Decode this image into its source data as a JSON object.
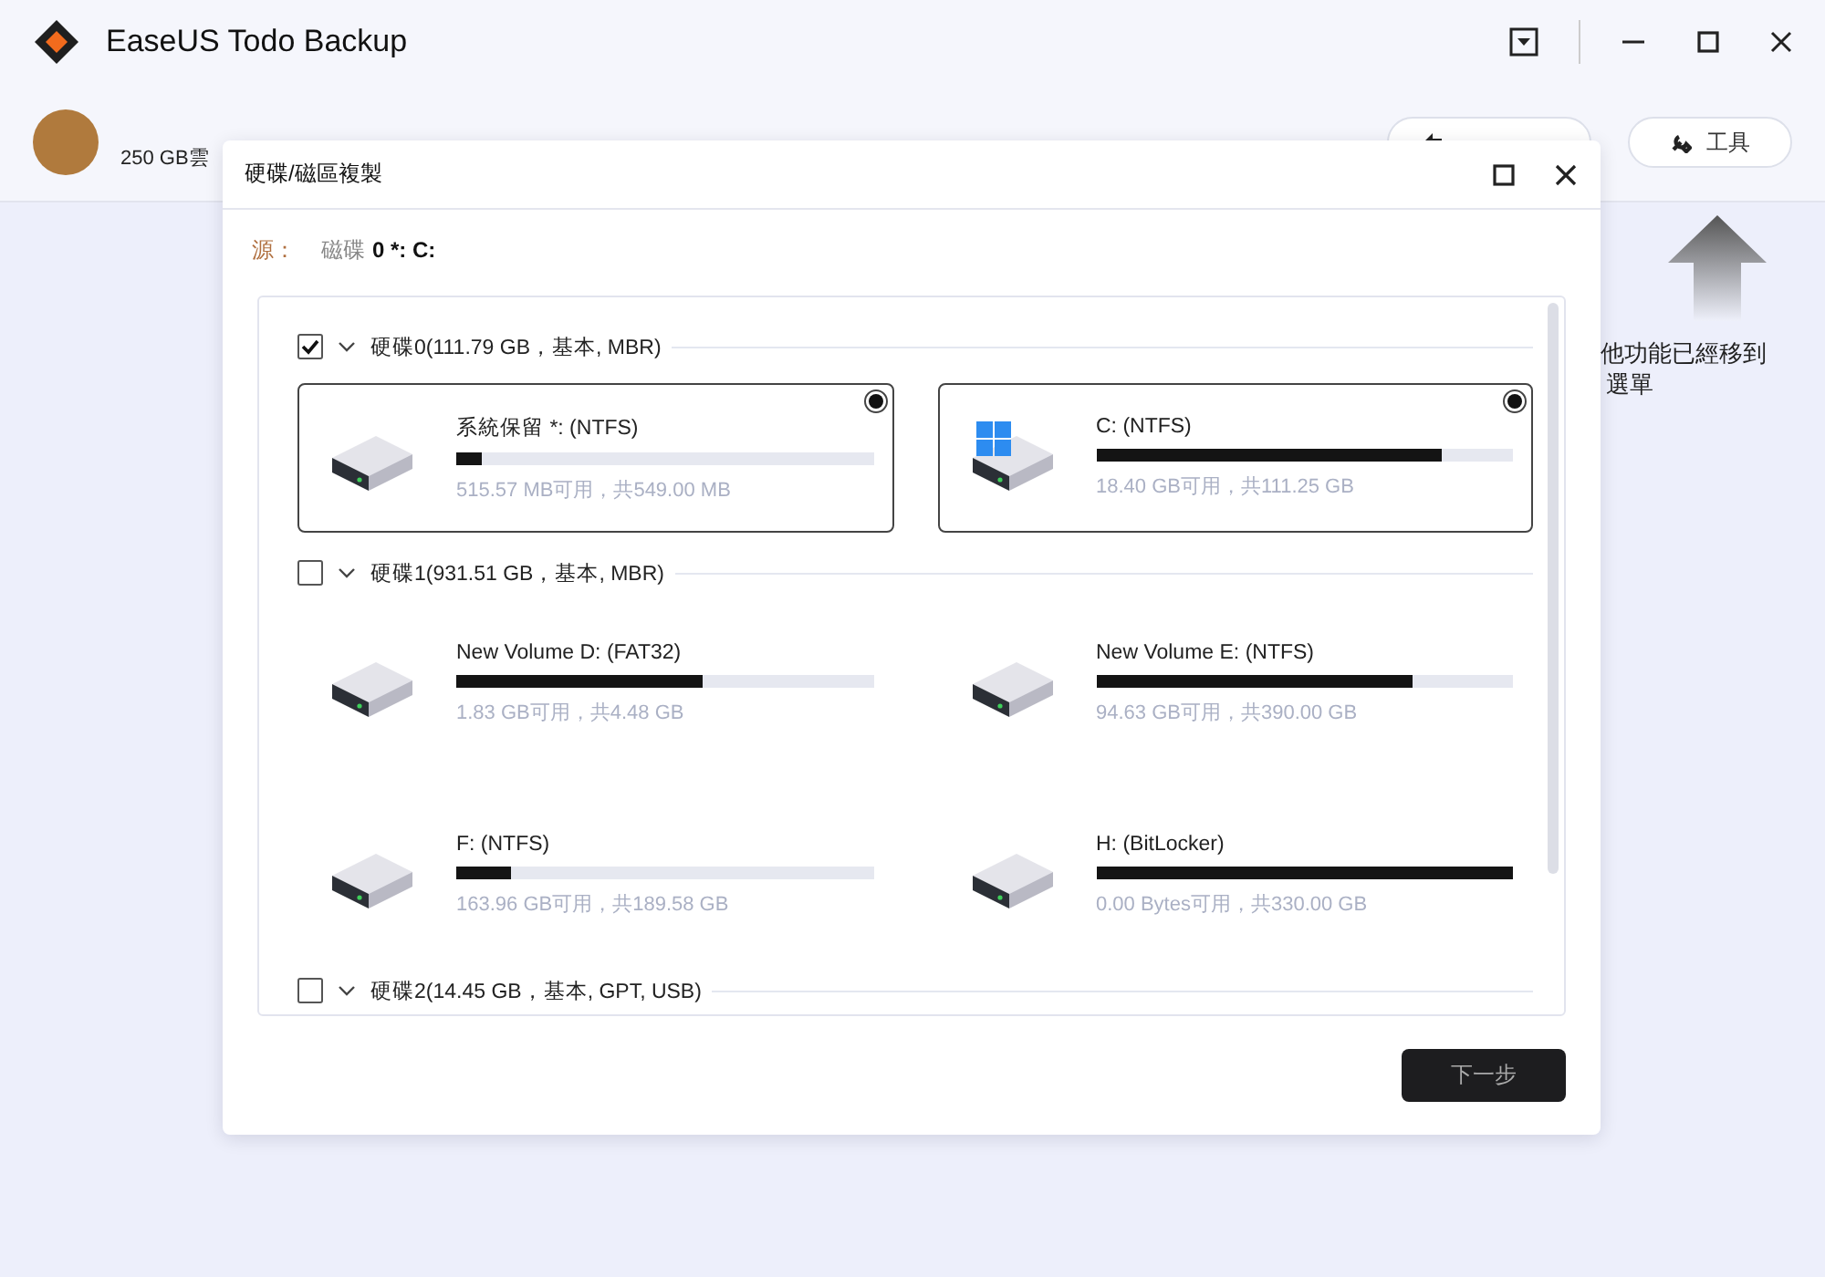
{
  "app": {
    "title": "EaseUS Todo Backup",
    "account": {
      "storage": "250 GB雲"
    },
    "buttons": [
      {
        "kind": "restore"
      },
      {
        "label": "工具",
        "kind": "tools"
      }
    ],
    "tip": {
      "lines": [
        "他功能已經移到",
        "選單"
      ]
    }
  },
  "dialog": {
    "title": "硬碟/磁區複製",
    "source": {
      "label": "源：",
      "disk": "磁碟",
      "value": "0 *: C:"
    },
    "disks": [
      {
        "label": "硬碟0(111.79 GB，基本, MBR)",
        "checked": true,
        "expanded": true,
        "partitions": [
          {
            "name": "系統保留 *: (NTFS)",
            "kind": "data",
            "selected": true,
            "level": 0.06,
            "free": "515.57 MB可用，共549.00 MB"
          },
          {
            "name": "C: (NTFS)",
            "kind": "system",
            "selected": true,
            "level": 0.83,
            "free": "18.40 GB可用，共111.25 GB"
          }
        ]
      },
      {
        "label": "硬碟1(931.51 GB，基本, MBR)",
        "checked": false,
        "expanded": true,
        "partitions": [
          {
            "name": "New Volume D: (FAT32)",
            "kind": "data",
            "selected": false,
            "level": 0.59,
            "free": "1.83 GB可用，共4.48 GB"
          },
          {
            "name": "New Volume E: (NTFS)",
            "kind": "data",
            "selected": false,
            "level": 0.76,
            "free": "94.63 GB可用，共390.00 GB"
          },
          {
            "name": "F: (NTFS)",
            "kind": "data",
            "selected": false,
            "level": 0.13,
            "free": "163.96 GB可用，共189.58 GB"
          },
          {
            "name": "H: (BitLocker)",
            "kind": "data",
            "selected": false,
            "level": 1,
            "free": "0.00 Bytes可用，共330.00 GB"
          }
        ]
      },
      {
        "label": "硬碟2(14.45 GB，基本, GPT, USB)",
        "checked": false,
        "expanded": true
      }
    ],
    "next_button": "下一步"
  }
}
